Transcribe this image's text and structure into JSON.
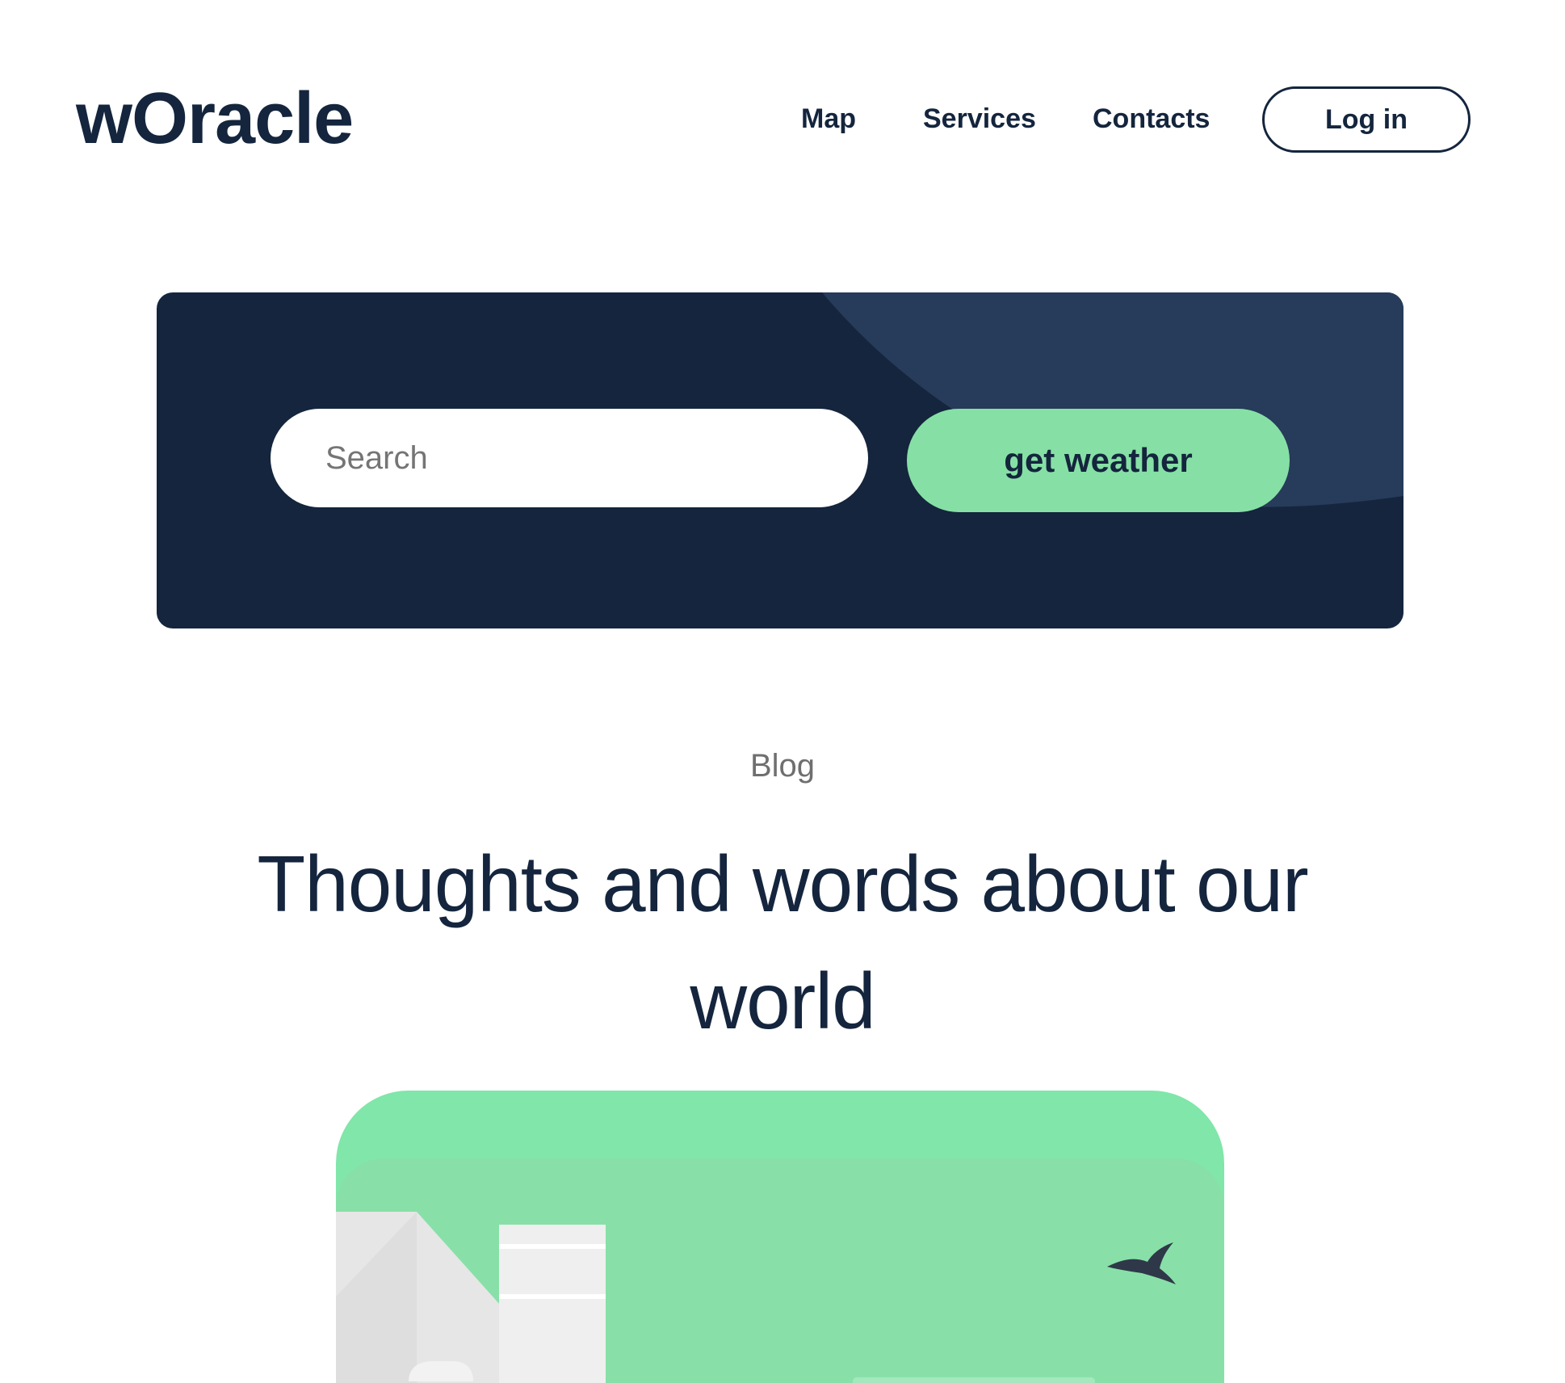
{
  "header": {
    "logo": "wOracle",
    "nav": [
      {
        "label": "Map"
      },
      {
        "label": "Services"
      },
      {
        "label": "Contacts"
      }
    ],
    "login_label": "Log in"
  },
  "hero": {
    "search": {
      "placeholder": "Search",
      "value": ""
    },
    "button_label": "get weather"
  },
  "blog": {
    "eyebrow": "Blog",
    "title": "Thoughts and words about our world"
  },
  "colors": {
    "navy": "#14253d",
    "navy_light": "#273b5a",
    "accent_green": "#86e0a5",
    "muted_text": "#6f6f6f"
  },
  "icons": {
    "bird": "bird-icon"
  }
}
